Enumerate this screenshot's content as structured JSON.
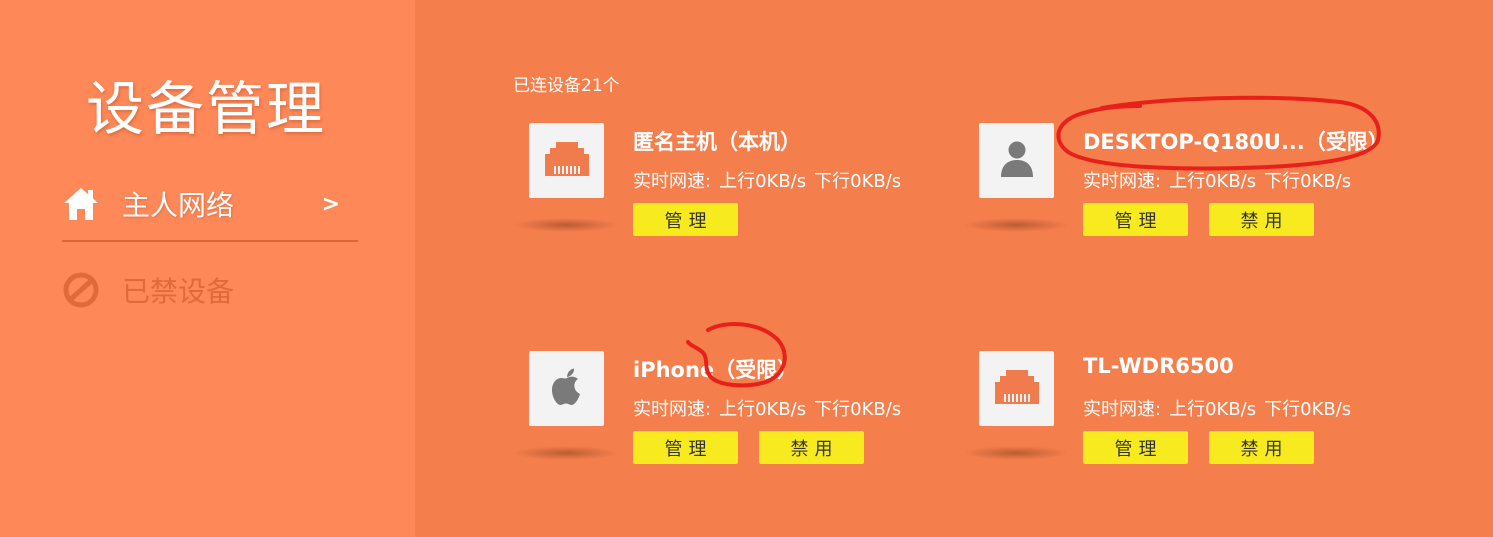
{
  "sidebar": {
    "title": "设备管理",
    "items": [
      {
        "label": "主人网络",
        "icon": "home-icon",
        "chevron": ">",
        "active": true
      },
      {
        "label": "已禁设备",
        "icon": "blocked-icon",
        "active": false
      }
    ]
  },
  "main": {
    "connected_count": "已连设备21个",
    "speed_prefix": "实时网速:",
    "devices": [
      {
        "name": "匿名主机（本机）",
        "icon": "ethernet-icon",
        "upload": "上行0KB/s",
        "download": "下行0KB/s",
        "manage_label": "管理",
        "block_label": null
      },
      {
        "name": "DESKTOP-Q180U...（受限）",
        "icon": "user-icon",
        "upload": "上行0KB/s",
        "download": "下行0KB/s",
        "manage_label": "管理",
        "block_label": "禁用"
      },
      {
        "name": "iPhone（受限）",
        "icon": "apple-icon",
        "upload": "上行0KB/s",
        "download": "下行0KB/s",
        "manage_label": "管理",
        "block_label": "禁用"
      },
      {
        "name": "TL-WDR6500",
        "icon": "ethernet-icon",
        "upload": "上行0KB/s",
        "download": "下行0KB/s",
        "manage_label": "管理",
        "block_label": "禁用"
      }
    ]
  },
  "colors": {
    "main_bg": "#F47E4C",
    "sidebar_bg": "#FF8858",
    "button_bg": "#F7EA1E",
    "annotation": "#E8201A"
  }
}
